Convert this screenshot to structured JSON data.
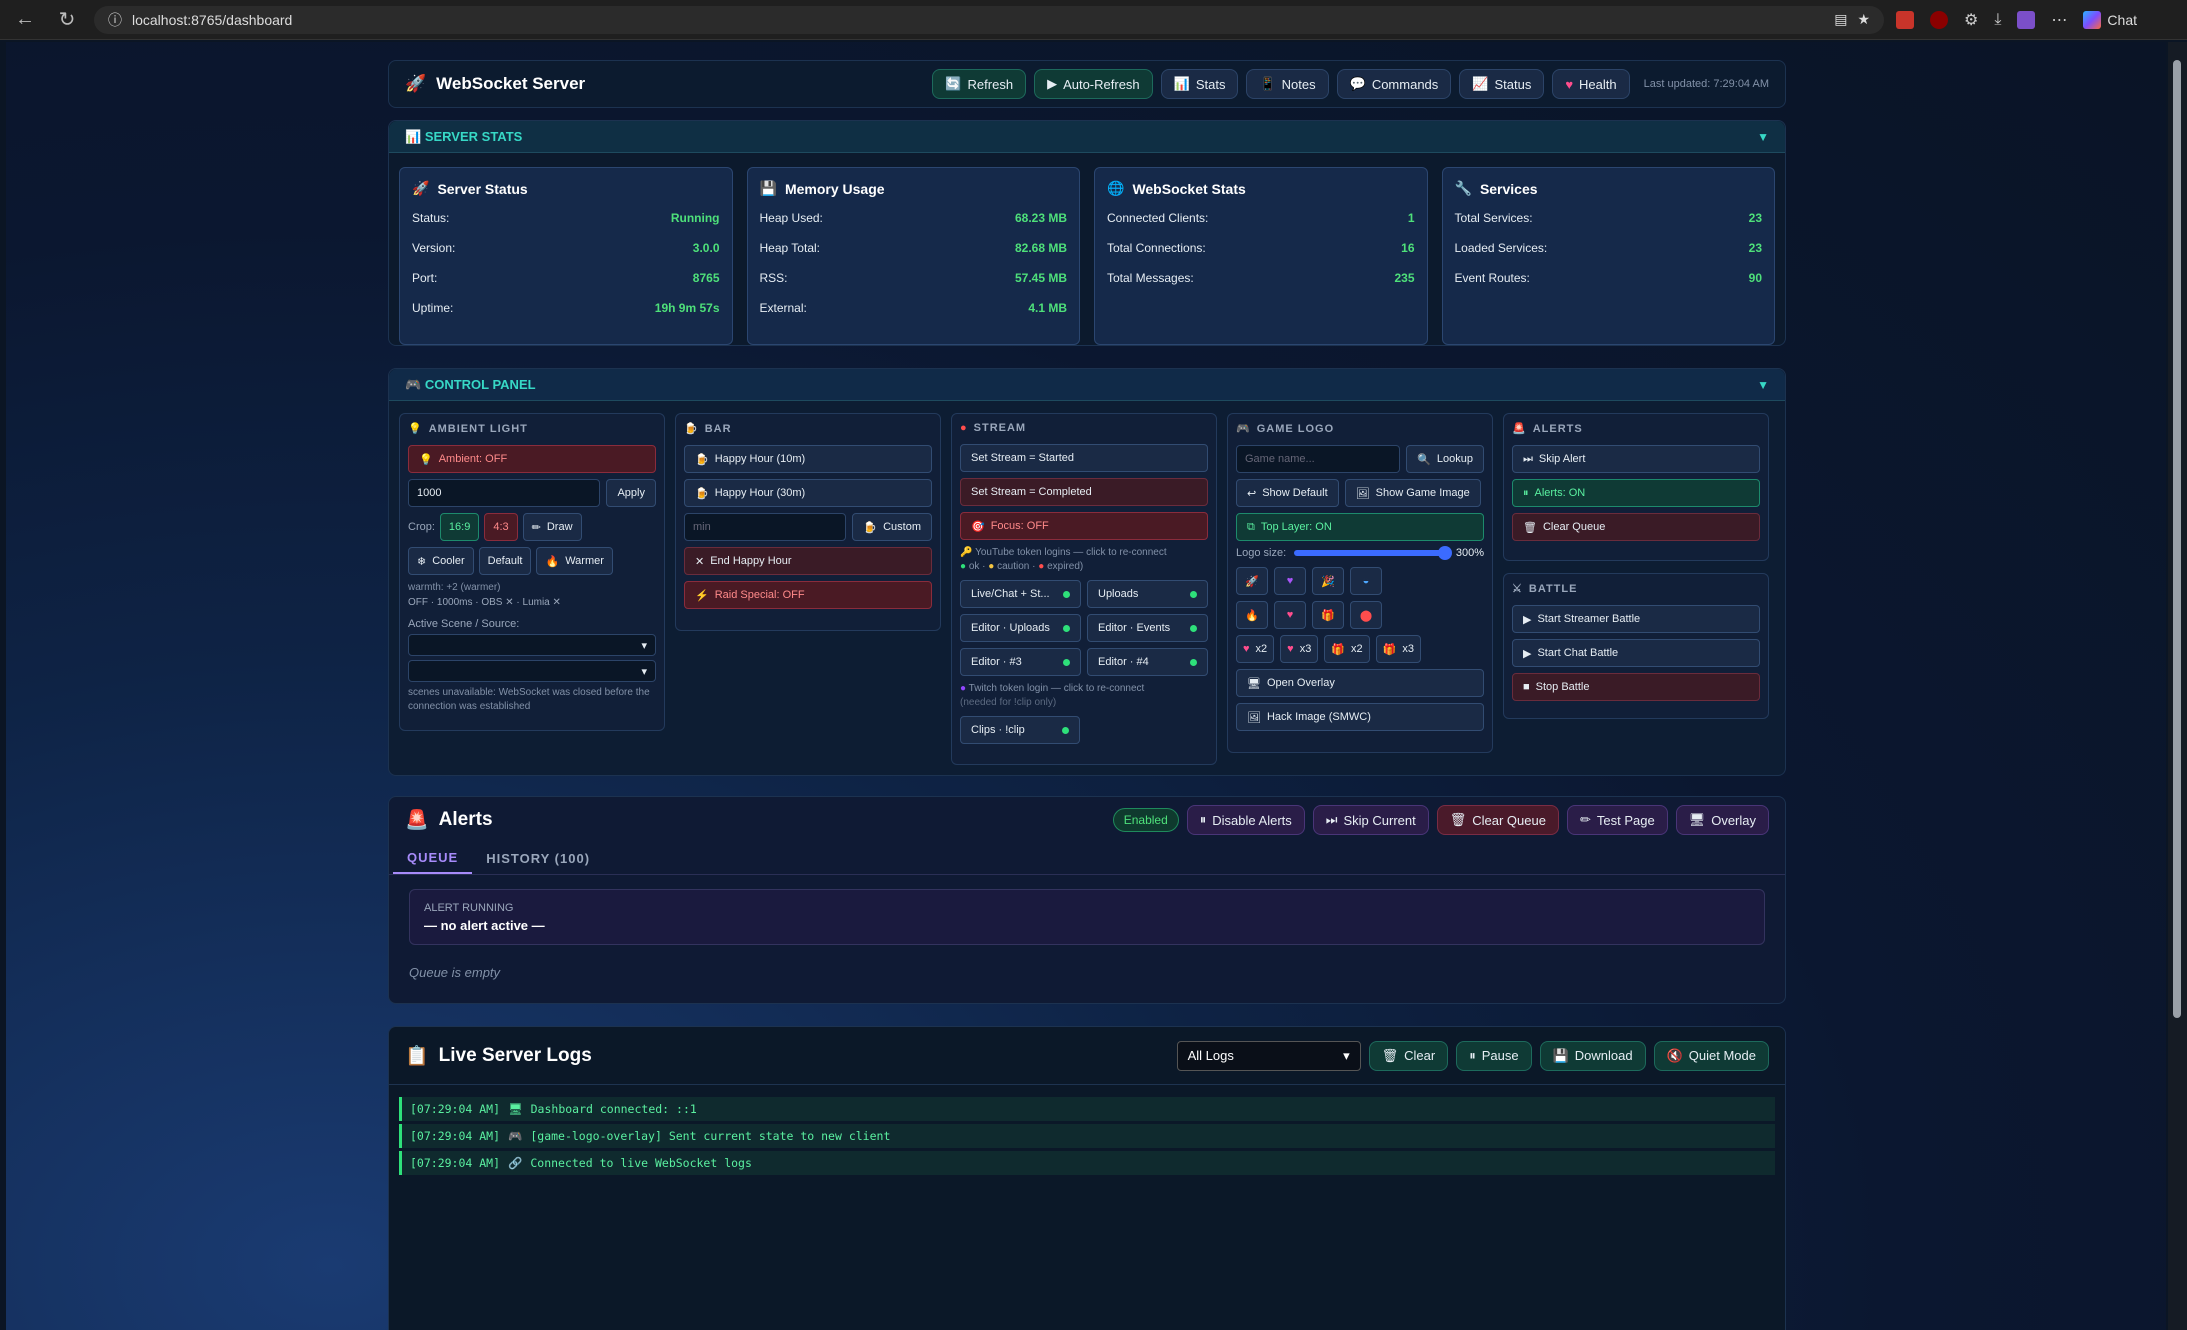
{
  "browser": {
    "url": "localhost:8765/dashboard",
    "chat_label": "Chat"
  },
  "topbar": {
    "title": "WebSocket Server",
    "buttons": [
      "Refresh",
      "Auto-Refresh",
      "Stats",
      "Notes",
      "Commands",
      "Status",
      "Health"
    ],
    "updated": "Last updated: 7:29:04 AM"
  },
  "server_stats": {
    "heading": "SERVER STATS",
    "cards": [
      {
        "title": "Server Status",
        "rows": [
          [
            "Status:",
            "Running"
          ],
          [
            "Version:",
            "3.0.0"
          ],
          [
            "Port:",
            "8765"
          ],
          [
            "Uptime:",
            "19h 9m 57s"
          ]
        ]
      },
      {
        "title": "Memory Usage",
        "rows": [
          [
            "Heap Used:",
            "68.23 MB"
          ],
          [
            "Heap Total:",
            "82.68 MB"
          ],
          [
            "RSS:",
            "57.45 MB"
          ],
          [
            "External:",
            "4.1 MB"
          ]
        ]
      },
      {
        "title": "WebSocket Stats",
        "rows": [
          [
            "Connected Clients:",
            "1"
          ],
          [
            "Total Connections:",
            "16"
          ],
          [
            "Total Messages:",
            "235"
          ]
        ]
      },
      {
        "title": "Services",
        "rows": [
          [
            "Total Services:",
            "23"
          ],
          [
            "Loaded Services:",
            "23"
          ],
          [
            "Event Routes:",
            "90"
          ]
        ]
      }
    ]
  },
  "control": {
    "heading": "CONTROL PANEL",
    "ambient": {
      "title": "AMBIENT LIGHT",
      "toggle": "Ambient: OFF",
      "value": "1000",
      "apply": "Apply",
      "crop_label": "Crop:",
      "crop169": "16:9",
      "crop43": "4:3",
      "draw": "Draw",
      "cooler": "Cooler",
      "default": "Default",
      "warmer": "Warmer",
      "warmth": "warmth: +2 (warmer)",
      "status": "OFF · 1000ms · OBS ✕ · Lumia ✕",
      "scene_label": "Active Scene / Source:",
      "scene_note": "scenes unavailable: WebSocket was closed before the connection was established"
    },
    "bar": {
      "title": "BAR",
      "hh10": "Happy Hour (10m)",
      "hh30": "Happy Hour (30m)",
      "min_ph": "min",
      "custom": "Custom",
      "end": "End Happy Hour",
      "raid": "Raid Special: OFF"
    },
    "stream": {
      "title": "STREAM",
      "started": "Set Stream = Started",
      "completed": "Set Stream = Completed",
      "focus": "Focus: OFF",
      "yt_note": "YouTube token logins — click to re-connect",
      "legend_ok": "ok ·",
      "legend_caution": "caution ·",
      "legend_expired": "expired)",
      "tokens": [
        "Live/Chat + St...",
        "Uploads",
        "Editor · Uploads",
        "Editor · Events",
        "Editor · #3",
        "Editor · #4"
      ],
      "twitch_note": "Twitch token login — click to re-connect",
      "twitch_sub": "(needed for !clip only)",
      "clips": "Clips · !clip"
    },
    "gamelogo": {
      "title": "GAME LOGO",
      "ph": "Game name...",
      "lookup": "Lookup",
      "show_default": "Show Default",
      "show_game": "Show Game Image",
      "top_layer": "Top Layer: ON",
      "size_label": "Logo size:",
      "size_val": "300%",
      "x2a": "x2",
      "x3a": "x3",
      "x2b": "x2",
      "x3b": "x3",
      "open_overlay": "Open Overlay",
      "hack": "Hack Image (SMWC)"
    },
    "alerts": {
      "title": "ALERTS",
      "skip": "Skip Alert",
      "on": "Alerts: ON",
      "clear": "Clear Queue"
    },
    "battle": {
      "title": "BATTLE",
      "streamer": "Start Streamer Battle",
      "chat": "Start Chat Battle",
      "stop": "Stop Battle"
    }
  },
  "alerts": {
    "title": "Alerts",
    "badge": "Enabled",
    "buttons": [
      "Disable Alerts",
      "Skip Current",
      "Clear Queue",
      "Test Page",
      "Overlay"
    ],
    "tab_queue": "QUEUE",
    "tab_history": "HISTORY (100)",
    "running_label": "ALERT RUNNING",
    "running_value": "— no alert active —",
    "queue_empty": "Queue is empty"
  },
  "logs": {
    "title": "Live Server Logs",
    "filter": "All Logs",
    "buttons": [
      "Clear",
      "Pause",
      "Download",
      "Quiet Mode"
    ],
    "lines": [
      {
        "time": "[07:29:04 AM]",
        "text": "Dashboard connected: ::1"
      },
      {
        "time": "[07:29:04 AM]",
        "text": "[game-logo-overlay] Sent current state to new client"
      },
      {
        "time": "[07:29:04 AM]",
        "text": "Connected to live WebSocket logs"
      }
    ]
  }
}
